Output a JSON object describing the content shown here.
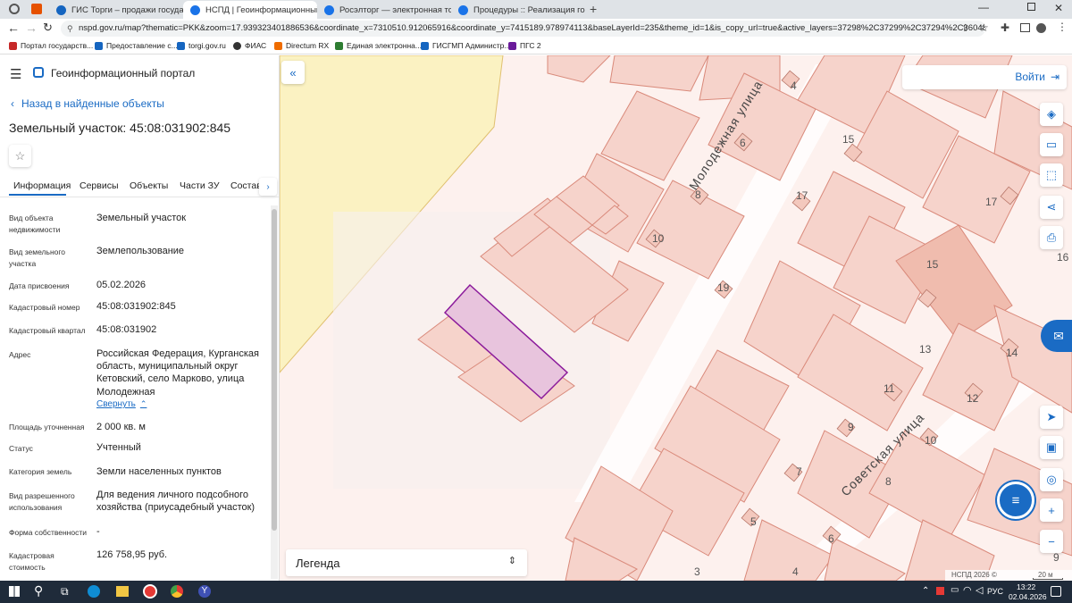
{
  "browser": {
    "tabs": [
      {
        "label": "ГИС Торги – продажи государс",
        "color": "#1565c0"
      },
      {
        "label": "НСПД | Геоинформационный п",
        "color": "#1a73e8",
        "active": true
      },
      {
        "label": "Росэлторг — электронная торг",
        "color": "#1a73e8"
      },
      {
        "label": "Процедуры :: Реализация госи",
        "color": "#1a73e8"
      }
    ],
    "url": "nspd.gov.ru/map?thematic=PKK&zoom=17.939323401886536&coordinate_x=7310510.912065916&coordinate_y=7415189.978974113&baseLayerId=235&theme_id=1&is_copy_url=true&active_layers=37298%2C37299%2C37294%2C36048&selectedCa...",
    "bookmarks": [
      {
        "label": "Портал государств...",
        "color": "#c62828"
      },
      {
        "label": "Предоставление с...",
        "color": "#1565c0"
      },
      {
        "label": "torgi.gov.ru",
        "color": "#1565c0"
      },
      {
        "label": "ФИАС",
        "color": "#333"
      },
      {
        "label": "Directum RX",
        "color": "#ef6c00"
      },
      {
        "label": "Единая электронна...",
        "color": "#2e7d32"
      },
      {
        "label": "ГИСГМП Администр...",
        "color": "#1565c0"
      },
      {
        "label": "ПГС 2",
        "color": "#6a1b9a"
      }
    ]
  },
  "header": {
    "title": "Геоинформационный портал"
  },
  "panel": {
    "back_label": "Назад в найденные объекты",
    "object_title": "Земельный участок: 45:08:031902:845",
    "tabs": [
      "Информация",
      "Сервисы",
      "Объекты",
      "Части ЗУ",
      "Состав"
    ],
    "fields": [
      {
        "label": "Вид объекта недвижимости",
        "value": "Земельный участок"
      },
      {
        "label": "Вид земельного участка",
        "value": "Землепользование"
      },
      {
        "label": "Дата присвоения",
        "value": "05.02.2026"
      },
      {
        "label": "Кадастровый номер",
        "value": "45:08:031902:845"
      },
      {
        "label": "Кадастровый квартал",
        "value": "45:08:031902"
      },
      {
        "label": "Адрес",
        "value": "Российская Федерация, Курганская область, муниципальный округ Кетовский, село Марково, улица Молодежная"
      },
      {
        "label": "Площадь уточненная",
        "value": "2 000 кв. м"
      },
      {
        "label": "Статус",
        "value": "Учтенный"
      },
      {
        "label": "Категория земель",
        "value": "Земли населенных пунктов"
      },
      {
        "label": "Вид разрешенного использования",
        "value": "Для ведения личного подсобного хозяйства (приусадебный участок)"
      },
      {
        "label": "Форма собственности",
        "value": "-"
      },
      {
        "label": "Кадастровая стоимость",
        "value": "126 758,95 руб."
      }
    ],
    "collapse_label": "Свернуть"
  },
  "map": {
    "login_label": "Войти",
    "legend_label": "Легенда",
    "street_1": "Молодежная улица",
    "street_2": "Советская улица",
    "house_numbers": [
      "4",
      "6",
      "8",
      "10",
      "15",
      "17",
      "19",
      "15",
      "17",
      "16",
      "13",
      "14",
      "11",
      "12",
      "9",
      "10",
      "7",
      "8",
      "5",
      "6",
      "3",
      "4",
      "9"
    ],
    "copyright": "НСПД 2026 ©",
    "scale": "20 м",
    "parcel_fill": "#e8c4dd",
    "parcel_stroke": "#8b1a9b"
  },
  "taskbar": {
    "time": "13:22",
    "date": "02.04.2026",
    "lang": "РУС"
  }
}
